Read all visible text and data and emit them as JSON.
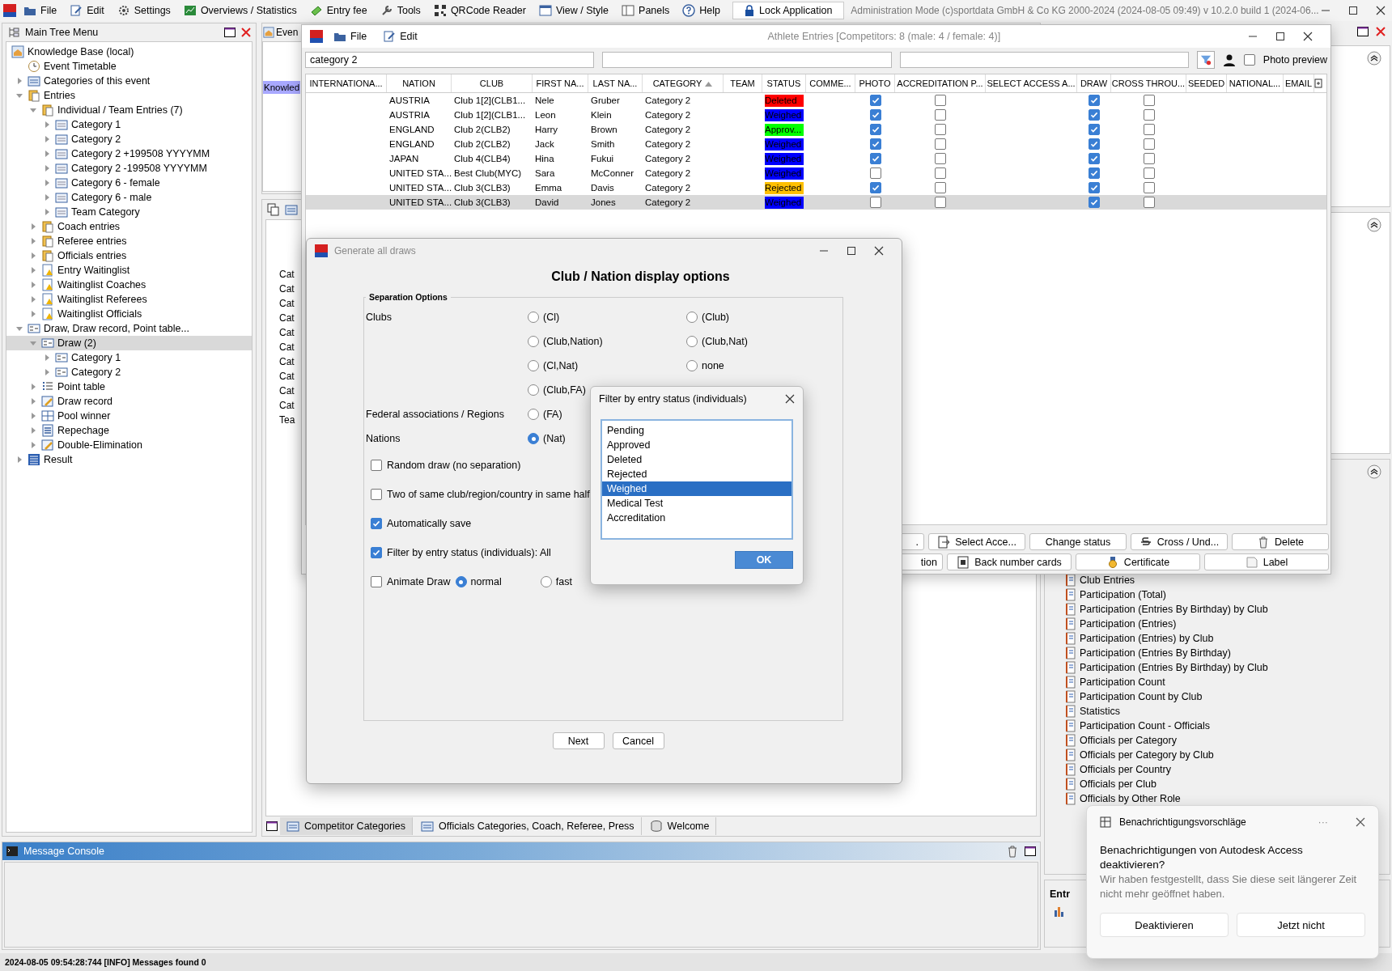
{
  "menu_bar": {
    "items": [
      "File",
      "Edit",
      "Settings",
      "Overviews / Statistics",
      "Entry fee",
      "Tools",
      "QRCode Reader",
      "View / Style",
      "Panels",
      "Help"
    ],
    "lock_button": "Lock Application",
    "title": "Administration Mode (c)sportdata GmbH & Co KG 2000-2024 (2024-08-05 09:49)  v 10.2.0 build 1 (2024-06..."
  },
  "tree": {
    "title": "Main Tree Menu",
    "items": [
      {
        "label": "Knowledge Base (local)",
        "kind": "base",
        "selected": false
      },
      {
        "label": "Event Timetable",
        "kind": "timetable",
        "selected": false
      },
      {
        "label": "Categories of this event",
        "kind": "categories",
        "expanded": false,
        "selected": false
      },
      {
        "label": "Entries",
        "kind": "entries",
        "expanded": true,
        "selected": false,
        "children": [
          {
            "label": "Individual / Team Entries (7)",
            "kind": "entries",
            "expanded": true,
            "selected": false,
            "children": [
              {
                "label": "Category 1",
                "kind": "category",
                "expanded": false,
                "selected": false
              },
              {
                "label": "Category 2",
                "kind": "category",
                "expanded": false,
                "selected": false
              },
              {
                "label": "Category 2 +199508 YYYYMM",
                "kind": "category",
                "expanded": false,
                "selected": false
              },
              {
                "label": "Category 2 -199508 YYYYMM",
                "kind": "category",
                "expanded": false,
                "selected": false
              },
              {
                "label": "Category 6 - female",
                "kind": "category",
                "expanded": false,
                "selected": false
              },
              {
                "label": "Category 6 - male",
                "kind": "category",
                "expanded": false,
                "selected": false
              },
              {
                "label": "Team Category",
                "kind": "category",
                "expanded": false,
                "selected": false
              }
            ]
          },
          {
            "label": "Coach entries",
            "kind": "entries",
            "expanded": false,
            "selected": false
          },
          {
            "label": "Referee entries",
            "kind": "entries",
            "expanded": false,
            "selected": false
          },
          {
            "label": "Officials entries",
            "kind": "entries",
            "expanded": false,
            "selected": false
          },
          {
            "label": "Entry Waitinglist",
            "kind": "waitlist",
            "expanded": false,
            "selected": false
          },
          {
            "label": "Waitinglist Coaches",
            "kind": "waitlist",
            "expanded": false,
            "selected": false
          },
          {
            "label": "Waitinglist Referees",
            "kind": "waitlist",
            "expanded": false,
            "selected": false
          },
          {
            "label": "Waitinglist Officials",
            "kind": "waitlist",
            "expanded": false,
            "selected": false
          }
        ]
      },
      {
        "label": "Draw, Draw record, Point table...",
        "kind": "draw",
        "expanded": true,
        "selected": false,
        "children": [
          {
            "label": "Draw (2)",
            "kind": "draw",
            "expanded": true,
            "selected": true,
            "children": [
              {
                "label": "Category 1",
                "kind": "draw",
                "expanded": false,
                "selected": false
              },
              {
                "label": "Category 2",
                "kind": "draw",
                "expanded": false,
                "selected": false
              }
            ]
          },
          {
            "label": "Point table",
            "kind": "points",
            "expanded": false,
            "selected": false
          },
          {
            "label": "Draw record",
            "kind": "record",
            "expanded": false,
            "selected": false
          },
          {
            "label": "Pool winner",
            "kind": "pool",
            "expanded": false,
            "selected": false
          },
          {
            "label": "Repechage",
            "kind": "repechage",
            "expanded": false,
            "selected": false
          },
          {
            "label": "Double-Elimination",
            "kind": "record",
            "expanded": false,
            "selected": false
          }
        ]
      },
      {
        "label": "Result",
        "kind": "result",
        "expanded": false,
        "selected": false
      }
    ]
  },
  "center": {
    "top_tab": "Even",
    "highlighted_item": "Knowled",
    "list": [
      "Cat",
      "Cat",
      "Cat",
      "Cat",
      "Cat",
      "Cat",
      "Cat",
      "Cat",
      "Cat",
      "Cat",
      "Tea"
    ],
    "tabs": [
      {
        "label": "Competitor Categories",
        "selected": true
      },
      {
        "label": "Officials Categories, Coach, Referee, Press",
        "selected": false
      },
      {
        "label": "Welcome",
        "selected": false
      }
    ]
  },
  "console": {
    "title": "Message Console"
  },
  "reports": {
    "items": [
      "Club Entries",
      "Participation (Total)",
      "Participation (Entries By Birthday) by Club",
      "Participation (Entries)",
      "Participation (Entries) by Club",
      "Participation (Entries By Birthday)",
      "Participation (Entries By Birthday) by Club",
      "Participation Count",
      "Participation Count by Club",
      "Statistics",
      "Participation Count - Officials",
      "Officials per Category",
      "Officials per Category by Club",
      "Officials per Country",
      "Officials per Club",
      "Officials by Other Role"
    ],
    "section_title": "Entr"
  },
  "status_bar": "2024-08-05 09:54:28:744 [INFO] Messages found 0",
  "athlete_window": {
    "title": "Athlete Entries [Competitors: 8 (male: 4 / female: 4)]",
    "menu": [
      "File",
      "Edit"
    ],
    "search": "category 2",
    "photo_preview": {
      "label": "Photo preview",
      "checked": false
    },
    "columns": [
      {
        "label": "INTERNATIONA...",
        "sorted": false
      },
      {
        "label": "NATION",
        "sorted": false
      },
      {
        "label": "CLUB",
        "sorted": false
      },
      {
        "label": "FIRST NA...",
        "sorted": false
      },
      {
        "label": "LAST NA...",
        "sorted": false
      },
      {
        "label": "CATEGORY",
        "sorted": true
      },
      {
        "label": "TEAM",
        "sorted": false
      },
      {
        "label": "STATUS",
        "sorted": false
      },
      {
        "label": "COMME...",
        "sorted": false
      },
      {
        "label": "PHOTO",
        "sorted": false
      },
      {
        "label": "ACCREDITATION P...",
        "sorted": false
      },
      {
        "label": "SELECT ACCESS A...",
        "sorted": false
      },
      {
        "label": "DRAW",
        "sorted": false
      },
      {
        "label": "CROSS THROU...",
        "sorted": false
      },
      {
        "label": "SEEDED",
        "sorted": false
      },
      {
        "label": "NATIONAL...",
        "sorted": false
      },
      {
        "label": "EMAIL",
        "sorted": false
      }
    ],
    "rows": [
      {
        "nation": "AUSTRIA",
        "club": "Club 1[2](CLB1...",
        "first_name": "Nele",
        "last_name": "Gruber",
        "category": "Category 2",
        "status": {
          "label": "Deleted",
          "color": "#ff0000"
        },
        "photo": true,
        "accreditation": false,
        "draw": true,
        "cross": false,
        "selected": false
      },
      {
        "nation": "AUSTRIA",
        "club": "Club 1[2](CLB1...",
        "first_name": "Leon",
        "last_name": "Klein",
        "category": "Category 2",
        "status": {
          "label": "Weighed",
          "color": "#0000ff"
        },
        "photo": true,
        "accreditation": false,
        "draw": true,
        "cross": false,
        "selected": false
      },
      {
        "nation": "ENGLAND",
        "club": "Club 2(CLB2)",
        "first_name": "Harry",
        "last_name": "Brown",
        "category": "Category 2",
        "status": {
          "label": "Approv...",
          "color": "#00ff00"
        },
        "photo": true,
        "accreditation": false,
        "draw": true,
        "cross": false,
        "selected": false
      },
      {
        "nation": "ENGLAND",
        "club": "Club 2(CLB2)",
        "first_name": "Jack",
        "last_name": "Smith",
        "category": "Category 2",
        "status": {
          "label": "Weighed",
          "color": "#0000ff"
        },
        "photo": true,
        "accreditation": false,
        "draw": true,
        "cross": false,
        "selected": false
      },
      {
        "nation": "JAPAN",
        "club": "Club 4(CLB4)",
        "first_name": "Hina",
        "last_name": "Fukui",
        "category": "Category 2",
        "status": {
          "label": "Weighed",
          "color": "#0000ff"
        },
        "photo": true,
        "accreditation": false,
        "draw": true,
        "cross": false,
        "selected": false
      },
      {
        "nation": "UNITED STA...",
        "club": "Best Club(MYC)",
        "first_name": "Sara",
        "last_name": "McConner",
        "category": "Category 2",
        "status": {
          "label": "Weighed",
          "color": "#0000ff"
        },
        "photo": false,
        "accreditation": false,
        "draw": true,
        "cross": false,
        "selected": false
      },
      {
        "nation": "UNITED STA...",
        "club": "Club 3(CLB3)",
        "first_name": "Emma",
        "last_name": "Davis",
        "category": "Category 2",
        "status": {
          "label": "Rejected",
          "color": "#ffc000"
        },
        "photo": true,
        "accreditation": false,
        "draw": true,
        "cross": false,
        "selected": false
      },
      {
        "nation": "UNITED STA...",
        "club": "Club 3(CLB3)",
        "first_name": "David",
        "last_name": "Jones",
        "category": "Category 2",
        "status": {
          "label": "Weighed",
          "color": "#0000ff"
        },
        "photo": false,
        "accreditation": false,
        "draw": true,
        "cross": false,
        "selected": true
      }
    ],
    "buttons_row_1": [
      {
        "label": ".",
        "kind": "plain"
      },
      {
        "label": "Select Acce...",
        "kind": "select"
      },
      {
        "label": "Change status",
        "kind": "plain"
      },
      {
        "label": "Cross / Und...",
        "kind": "cross"
      },
      {
        "label": "Delete",
        "kind": "delete"
      }
    ],
    "buttons_row_2": [
      {
        "label": "tion",
        "kind": "plain"
      },
      {
        "label": "Back number cards",
        "kind": "number"
      },
      {
        "label": "Certificate",
        "kind": "certificate"
      },
      {
        "label": "Label",
        "kind": "label"
      }
    ]
  },
  "draw_dialog": {
    "title": "Generate all draws",
    "heading": "Club / Nation display options",
    "group_title": "Separation Options",
    "radio_rows": [
      {
        "label": "Clubs",
        "options": [
          {
            "label": "(Cl)",
            "selected": false
          },
          {
            "label": "(Club)",
            "selected": false
          }
        ]
      },
      {
        "options": [
          {
            "label": "(Club,Nation)",
            "selected": false
          },
          {
            "label": "(Club,Nat)",
            "selected": false
          }
        ]
      },
      {
        "options": [
          {
            "label": "(Cl,Nat)",
            "selected": false
          },
          {
            "label": "none",
            "selected": false
          }
        ]
      },
      {
        "options": [
          {
            "label": "(Club,FA)",
            "selected": false
          }
        ]
      },
      {
        "label": "Federal associations / Regions",
        "options": [
          {
            "label": "(FA)",
            "selected": false
          }
        ]
      },
      {
        "label": "Nations",
        "options": [
          {
            "label": "(Nat)",
            "selected": true
          }
        ]
      }
    ],
    "checkboxes": [
      {
        "label": "Random draw (no separation)",
        "checked": false
      },
      {
        "label": "Two of same club/region/country in same half",
        "checked": false
      },
      {
        "label": "Automatically save",
        "checked": true
      },
      {
        "label": "Filter by entry status (individuals): All",
        "checked": true
      }
    ],
    "animate": {
      "label": "Animate Draw",
      "checked": false,
      "speeds": [
        {
          "label": "normal",
          "selected": true
        },
        {
          "label": "fast",
          "selected": false
        }
      ]
    },
    "buttons": [
      "Next",
      "Cancel"
    ]
  },
  "filter_dialog": {
    "title": "Filter by entry status (individuals)",
    "items": [
      {
        "label": "Pending",
        "selected": false
      },
      {
        "label": "Approved",
        "selected": false
      },
      {
        "label": "Deleted",
        "selected": false
      },
      {
        "label": "Rejected",
        "selected": false
      },
      {
        "label": "Weighed",
        "selected": true
      },
      {
        "label": "Medical Test",
        "selected": false
      },
      {
        "label": "Accreditation",
        "selected": false
      }
    ],
    "ok": "OK"
  },
  "notification": {
    "app": "Benachrichtigungsvorschläge",
    "more": "···",
    "title": "Benachrichtigungen von Autodesk Access deaktivieren?",
    "body": "Wir haben festgestellt, dass Sie diese seit längerer Zeit nicht mehr geöffnet haben.",
    "buttons": [
      "Deaktivieren",
      "Jetzt nicht"
    ]
  }
}
